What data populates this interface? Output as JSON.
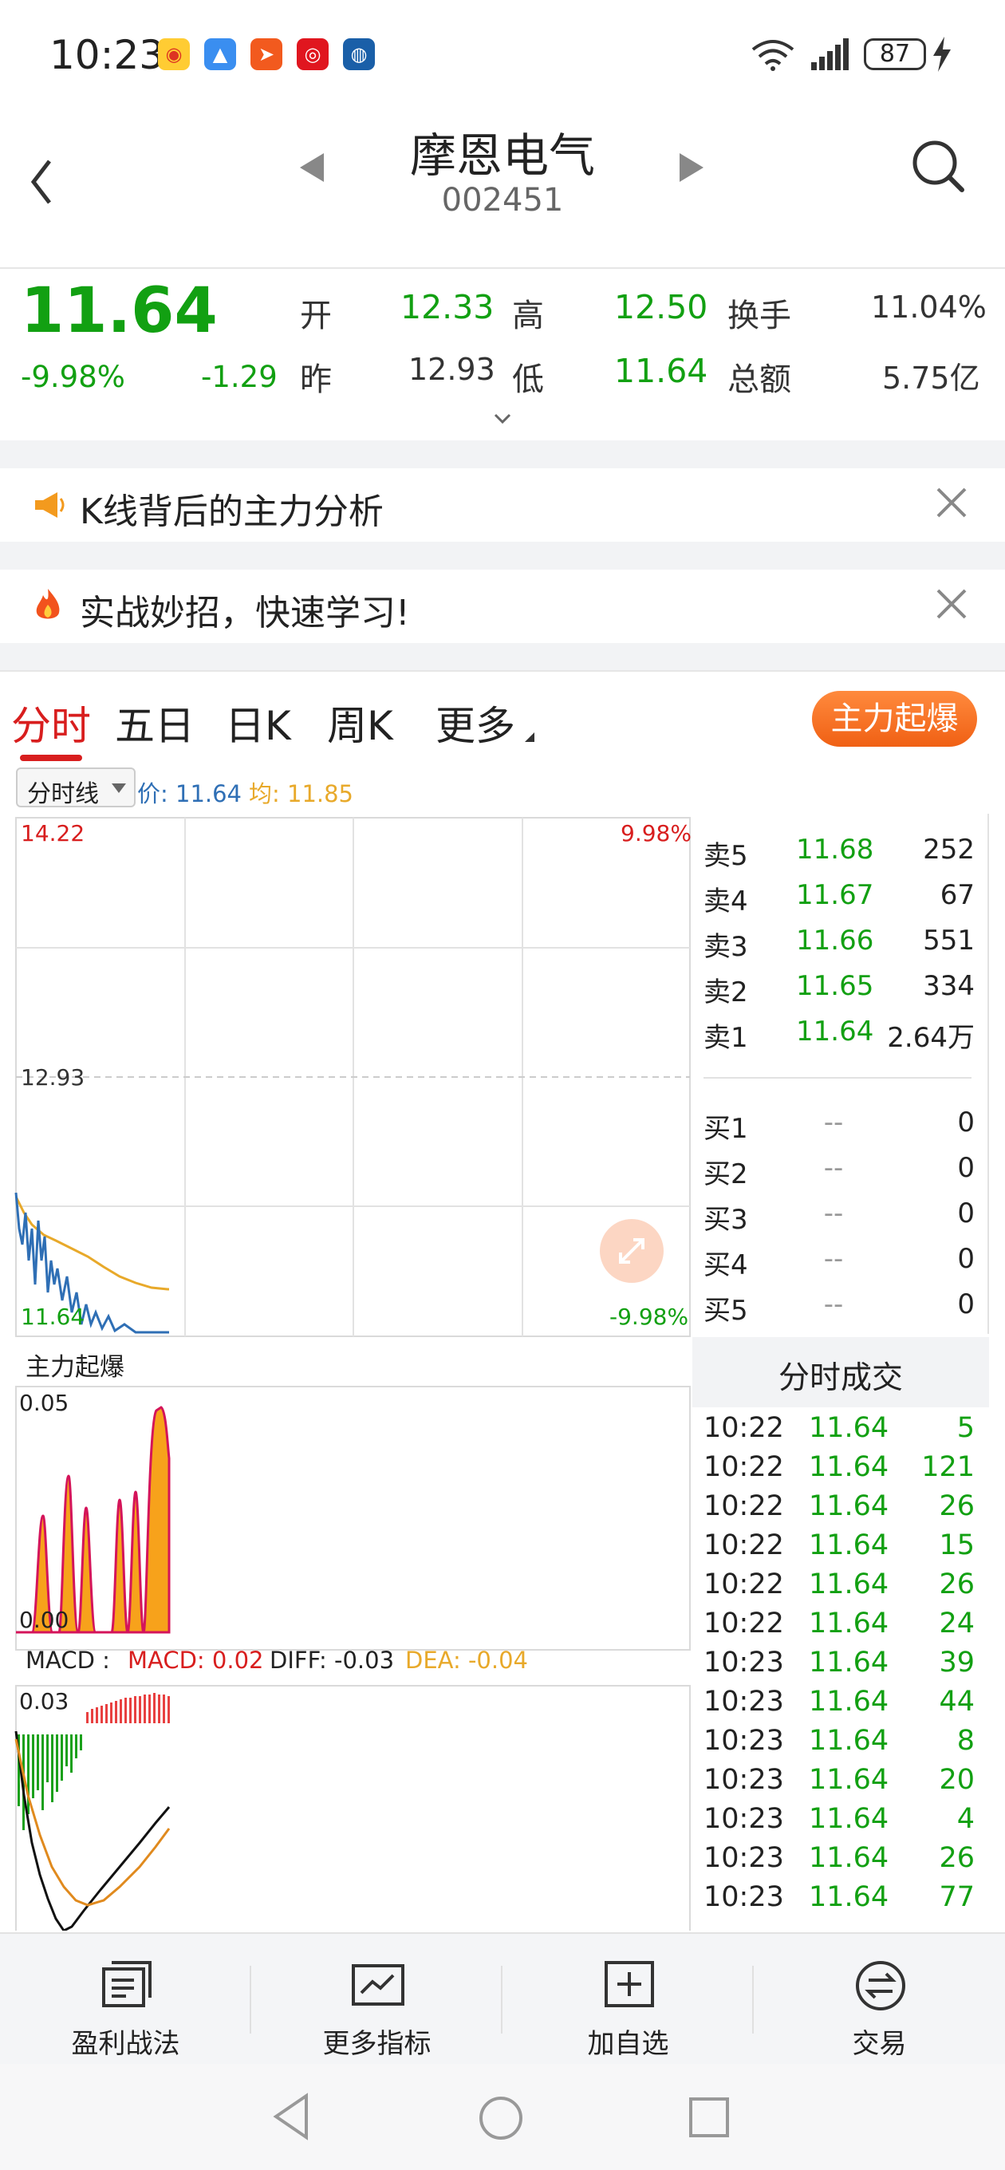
{
  "status_bar": {
    "time": "10:23",
    "battery": "87",
    "app_icons": [
      "weibo-icon",
      "map-app-icon",
      "send-app-icon",
      "stock-app-icon",
      "browser-app-icon"
    ]
  },
  "header": {
    "stock_name": "摩恩电气",
    "stock_code": "002451"
  },
  "quote": {
    "price": "11.64",
    "change_pct": "-9.98%",
    "change": "-1.29",
    "open_label": "开",
    "open": "12.33",
    "high_label": "高",
    "high": "12.50",
    "turnover_label": "换手",
    "turnover": "11.04%",
    "prev_label": "昨",
    "prev": "12.93",
    "low_label": "低",
    "low": "11.64",
    "amount_label": "总额",
    "amount": "5.75亿"
  },
  "banners": [
    {
      "text": "K线背后的主力分析",
      "icon": "megaphone-icon"
    },
    {
      "text": "实战妙招，快速学习!",
      "icon": "fire-icon"
    }
  ],
  "tabs": {
    "items": [
      "分时",
      "五日",
      "日K",
      "周K",
      "更多"
    ],
    "active": 0,
    "hot_button": "主力起爆"
  },
  "chart_toolbar": {
    "selector": "分时线",
    "price_label": "价: 11.64",
    "avg_label": "均: 11.85"
  },
  "price_chart": {
    "top_price": "14.22",
    "top_pct": "9.98%",
    "mid_price": "12.93",
    "bottom_price": "11.64",
    "bottom_pct": "-9.98%"
  },
  "burst_panel": {
    "title": "主力起爆",
    "top": "0.05",
    "bottom": "0.00"
  },
  "macd_panel": {
    "title": "MACD :",
    "macd": "MACD: 0.02",
    "diff": "DIFF: -0.03",
    "dea": "DEA: -0.04",
    "top": "0.03"
  },
  "colors": {
    "rise": "#d81e1e",
    "fall": "#12a012",
    "price_line": "#2f6fb5",
    "avg_line": "#e8a92a",
    "burst_fill": "#f7a21b",
    "burst_line": "#d4145a",
    "accent": "#f06014"
  },
  "order_book": {
    "sells": [
      {
        "label": "卖5",
        "price": "11.68",
        "vol": "252"
      },
      {
        "label": "卖4",
        "price": "11.67",
        "vol": "67"
      },
      {
        "label": "卖3",
        "price": "11.66",
        "vol": "551"
      },
      {
        "label": "卖2",
        "price": "11.65",
        "vol": "334"
      },
      {
        "label": "卖1",
        "price": "11.64",
        "vol": "2.64万"
      }
    ],
    "buys": [
      {
        "label": "买1",
        "price": "--",
        "vol": "0"
      },
      {
        "label": "买2",
        "price": "--",
        "vol": "0"
      },
      {
        "label": "买3",
        "price": "--",
        "vol": "0"
      },
      {
        "label": "买4",
        "price": "--",
        "vol": "0"
      },
      {
        "label": "买5",
        "price": "--",
        "vol": "0"
      }
    ]
  },
  "trades": {
    "title": "分时成交",
    "rows": [
      {
        "time": "10:22",
        "price": "11.64",
        "vol": "5"
      },
      {
        "time": "10:22",
        "price": "11.64",
        "vol": "121"
      },
      {
        "time": "10:22",
        "price": "11.64",
        "vol": "26"
      },
      {
        "time": "10:22",
        "price": "11.64",
        "vol": "15"
      },
      {
        "time": "10:22",
        "price": "11.64",
        "vol": "26"
      },
      {
        "time": "10:22",
        "price": "11.64",
        "vol": "24"
      },
      {
        "time": "10:23",
        "price": "11.64",
        "vol": "39"
      },
      {
        "time": "10:23",
        "price": "11.64",
        "vol": "44"
      },
      {
        "time": "10:23",
        "price": "11.64",
        "vol": "8"
      },
      {
        "time": "10:23",
        "price": "11.64",
        "vol": "20"
      },
      {
        "time": "10:23",
        "price": "11.64",
        "vol": "4"
      },
      {
        "time": "10:23",
        "price": "11.64",
        "vol": "26"
      },
      {
        "time": "10:23",
        "price": "11.64",
        "vol": "77"
      }
    ]
  },
  "bottom_nav": [
    "盈利战法",
    "更多指标",
    "加自选",
    "交易"
  ]
}
